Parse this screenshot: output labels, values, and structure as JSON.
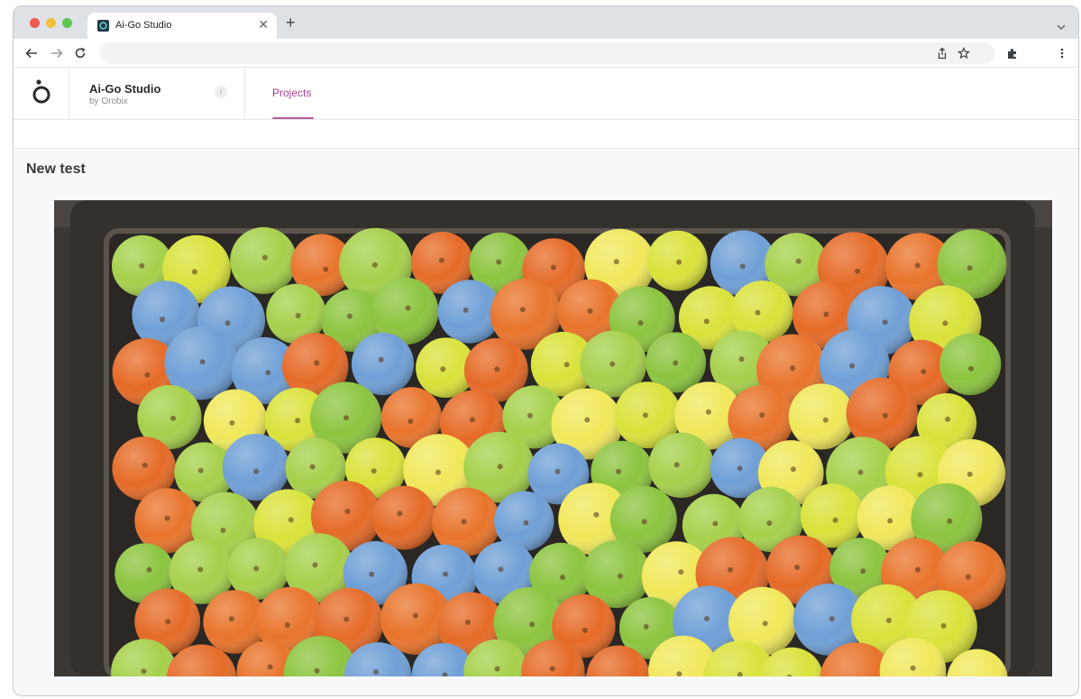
{
  "browser": {
    "tab_title": "Ai-Go Studio",
    "tab_close_icon": "close-icon",
    "new_tab_icon": "plus-icon",
    "address": ""
  },
  "app": {
    "brand_name": "Ai-Go Studio",
    "brand_sub": "by Orobix",
    "nav": {
      "projects_label": "Projects",
      "active": "Projects"
    },
    "accent_color": "#a4428f"
  },
  "page": {
    "title": "New test"
  }
}
